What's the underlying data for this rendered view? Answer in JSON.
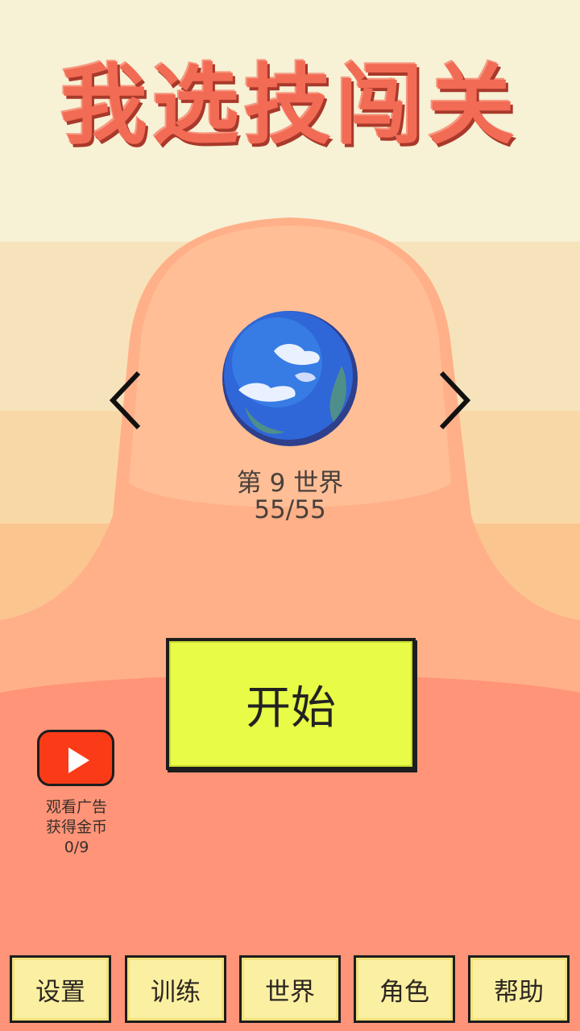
{
  "title": "我选技闯关",
  "world": {
    "name": "第 9 世界",
    "progress": "55/55"
  },
  "start_label": "开始",
  "ad": {
    "icon": "play-video-icon",
    "line1": "观看广告",
    "line2": "获得金币",
    "count": "0/9"
  },
  "nav": [
    "设置",
    "训练",
    "世界",
    "角色",
    "帮助"
  ],
  "colors": {
    "title": "#f26b55",
    "start_button": "#e8fb46",
    "nav_button": "#fbf0a2",
    "ad_button": "#fb3b17",
    "planet_ocean": "#2f66d8"
  }
}
